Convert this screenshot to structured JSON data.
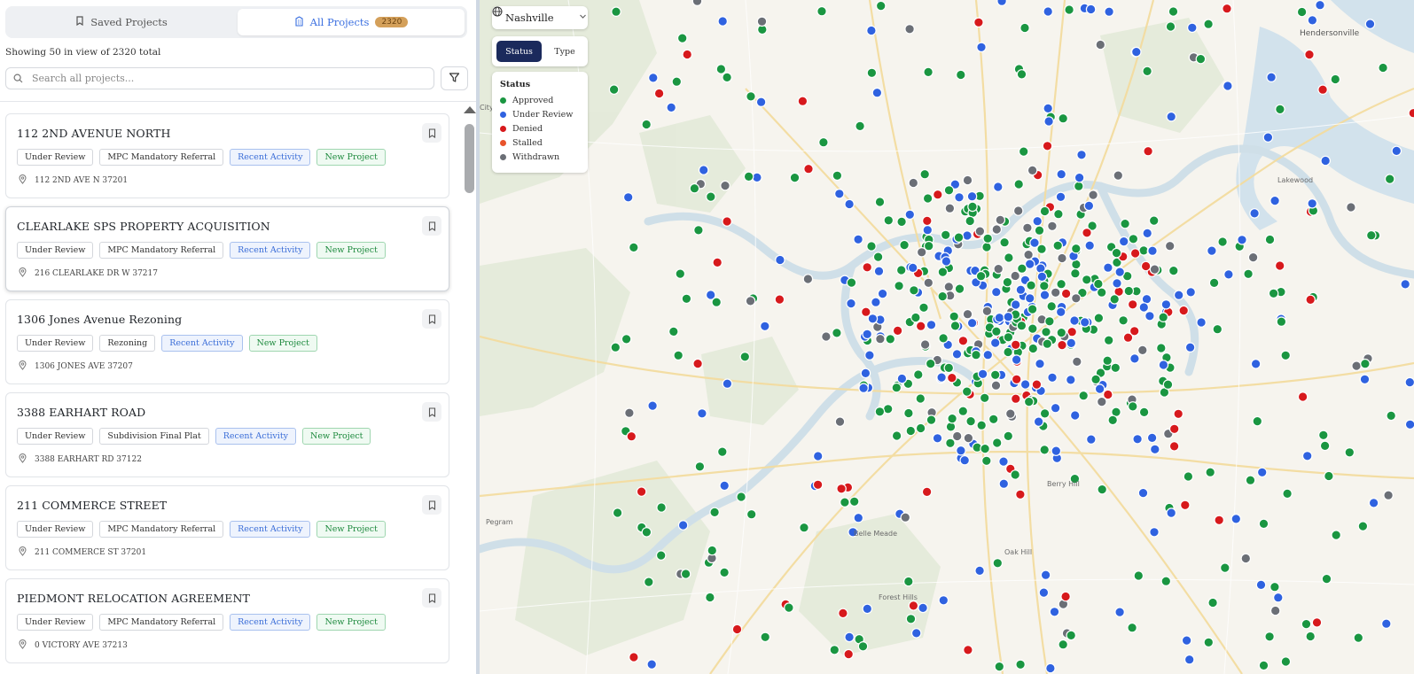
{
  "tabs": {
    "saved_label": "Saved Projects",
    "all_label": "All Projects",
    "all_count": "2320"
  },
  "showing_text": "Showing 50 in view of 2320 total",
  "search": {
    "placeholder": "Search all projects..."
  },
  "projects": [
    {
      "title": "112 2ND AVENUE NORTH",
      "tags": [
        "Under Review",
        "MPC Mandatory Referral",
        "Recent Activity",
        "New Project"
      ],
      "address": "112 2ND AVE N 37201"
    },
    {
      "title": "CLEARLAKE SPS PROPERTY ACQUISITION",
      "tags": [
        "Under Review",
        "MPC Mandatory Referral",
        "Recent Activity",
        "New Project"
      ],
      "address": "216 CLEARLAKE DR W 37217"
    },
    {
      "title": "1306 Jones Avenue Rezoning",
      "tags": [
        "Under Review",
        "Rezoning",
        "Recent Activity",
        "New Project"
      ],
      "address": "1306 JONES AVE 37207"
    },
    {
      "title": "3388 EARHART ROAD",
      "tags": [
        "Under Review",
        "Subdivision Final Plat",
        "Recent Activity",
        "New Project"
      ],
      "address": "3388 EARHART RD 37122"
    },
    {
      "title": "211 COMMERCE STREET",
      "tags": [
        "Under Review",
        "MPC Mandatory Referral",
        "Recent Activity",
        "New Project"
      ],
      "address": "211 COMMERCE ST 37201"
    },
    {
      "title": "PIEDMONT RELOCATION AGREEMENT",
      "tags": [
        "Under Review",
        "MPC Mandatory Referral",
        "Recent Activity",
        "New Project"
      ],
      "address": "0 VICTORY AVE 37213"
    }
  ],
  "map": {
    "location_label": "Nashville",
    "toggle": {
      "status_label": "Status",
      "type_label": "Type"
    },
    "legend": {
      "title": "Status",
      "items": [
        {
          "label": "Approved",
          "color": "#1a9641"
        },
        {
          "label": "Under Review",
          "color": "#2f62e0"
        },
        {
          "label": "Denied",
          "color": "#d7191c"
        },
        {
          "label": "Stalled",
          "color": "#e8532b"
        },
        {
          "label": "Withdrawn",
          "color": "#6b6f76"
        }
      ]
    },
    "places": [
      "Hendersonville",
      "Lakewood",
      "Berry Hill",
      "Belle Meade",
      "Oak Hill",
      "Forest Hills",
      "Pegram",
      "City"
    ]
  }
}
